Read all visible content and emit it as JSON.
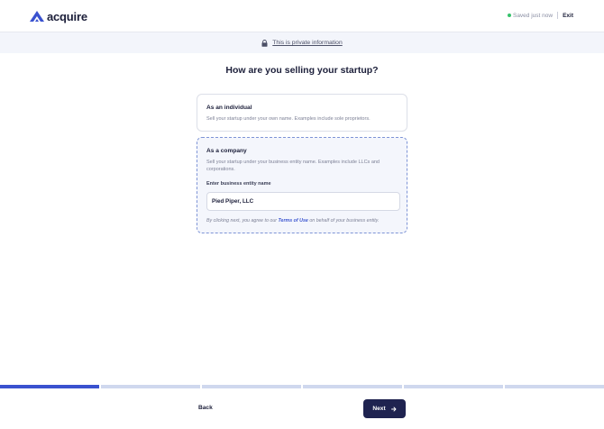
{
  "header": {
    "brand": "acquire",
    "saved_status": "Saved just now",
    "exit_label": "Exit",
    "brand_color": "#3a52cf",
    "saved_dot_color": "#36c26b"
  },
  "privacy_banner": {
    "icon": "lock-icon",
    "text": "This is private information"
  },
  "page": {
    "title": "How are you selling your startup?"
  },
  "options": {
    "individual": {
      "title": "As an individual",
      "description": "Sell your startup under your own name. Examples include sole proprietors."
    },
    "company": {
      "title": "As a company",
      "description": "Sell your startup under your business entity name. Examples include LLCs and corporations.",
      "field_label": "Enter business entity name",
      "field_value": "Pied Piper, LLC",
      "terms_prefix": "By clicking next, you agree to our ",
      "terms_link": "Terms of Use",
      "terms_suffix": " on behalf of your business entity."
    }
  },
  "progress": {
    "total_steps": 6,
    "current_step": 1
  },
  "footer": {
    "back_label": "Back",
    "next_label": "Next",
    "next_icon": "arrow-right-icon"
  }
}
